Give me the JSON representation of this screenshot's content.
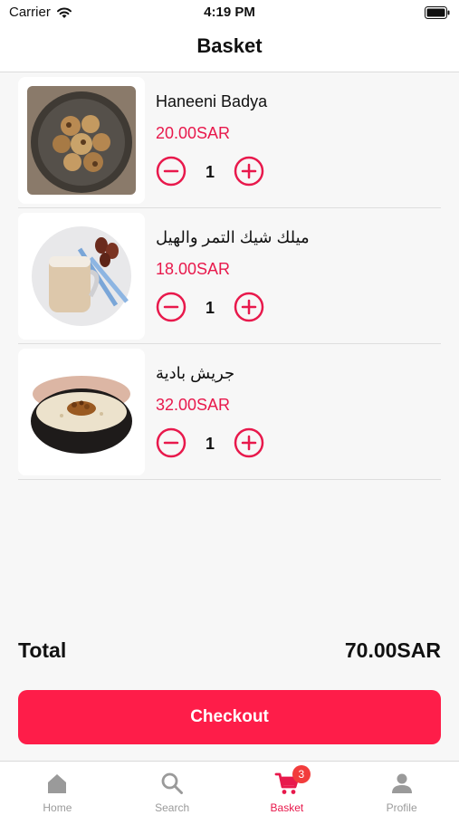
{
  "status_bar": {
    "carrier": "Carrier",
    "time": "4:19 PM"
  },
  "header": {
    "title": "Basket"
  },
  "items": [
    {
      "name": "Haneeni Badya",
      "price": "20.00SAR",
      "qty": "1",
      "image": "cookies-plate-image"
    },
    {
      "name": "ميلك شيك التمر والهيل",
      "price": "18.00SAR",
      "qty": "1",
      "image": "date-milkshake-image"
    },
    {
      "name": "جريش بادية",
      "price": "32.00SAR",
      "qty": "1",
      "image": "jareesh-bowl-image"
    }
  ],
  "total": {
    "label": "Total",
    "value": "70.00SAR"
  },
  "checkout": {
    "label": "Checkout"
  },
  "tabs": [
    {
      "label": "Home",
      "icon": "home-icon"
    },
    {
      "label": "Search",
      "icon": "search-icon"
    },
    {
      "label": "Basket",
      "icon": "cart-icon",
      "badge": "3",
      "active": true
    },
    {
      "label": "Profile",
      "icon": "person-icon"
    }
  ],
  "colors": {
    "accent": "#fe1d49",
    "price": "#e8194c",
    "badge": "#f23c3c"
  }
}
